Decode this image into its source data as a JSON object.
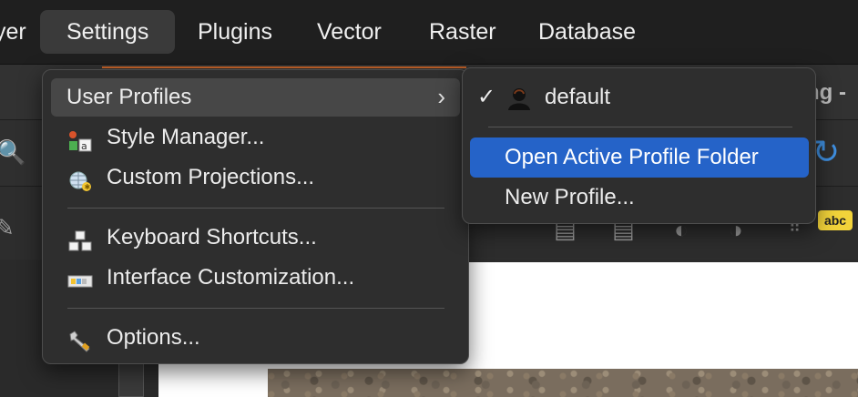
{
  "menubar": {
    "items": [
      "yer",
      "Settings",
      "Plugins",
      "Vector",
      "Raster",
      "Database"
    ]
  },
  "background": {
    "title_fragment": "ng -",
    "label_badge": "abc"
  },
  "settings_menu": {
    "items": [
      {
        "label": "User Profiles",
        "icon": "none",
        "submenu": true
      },
      {
        "label": "Style Manager...",
        "icon": "style-manager-icon"
      },
      {
        "label": "Custom Projections...",
        "icon": "globe-star-icon"
      },
      {
        "label": "Keyboard Shortcuts...",
        "icon": "shortcut-blocks-icon"
      },
      {
        "label": "Interface Customization...",
        "icon": "interface-panel-icon"
      },
      {
        "label": "Options...",
        "icon": "wrench-icon"
      }
    ]
  },
  "profiles_submenu": {
    "check": "✓",
    "profile": "default",
    "items": [
      {
        "label": "Open Active Profile Folder"
      },
      {
        "label": "New Profile..."
      }
    ]
  },
  "colors": {
    "selection": "#2563c8",
    "hover": "#474747"
  }
}
